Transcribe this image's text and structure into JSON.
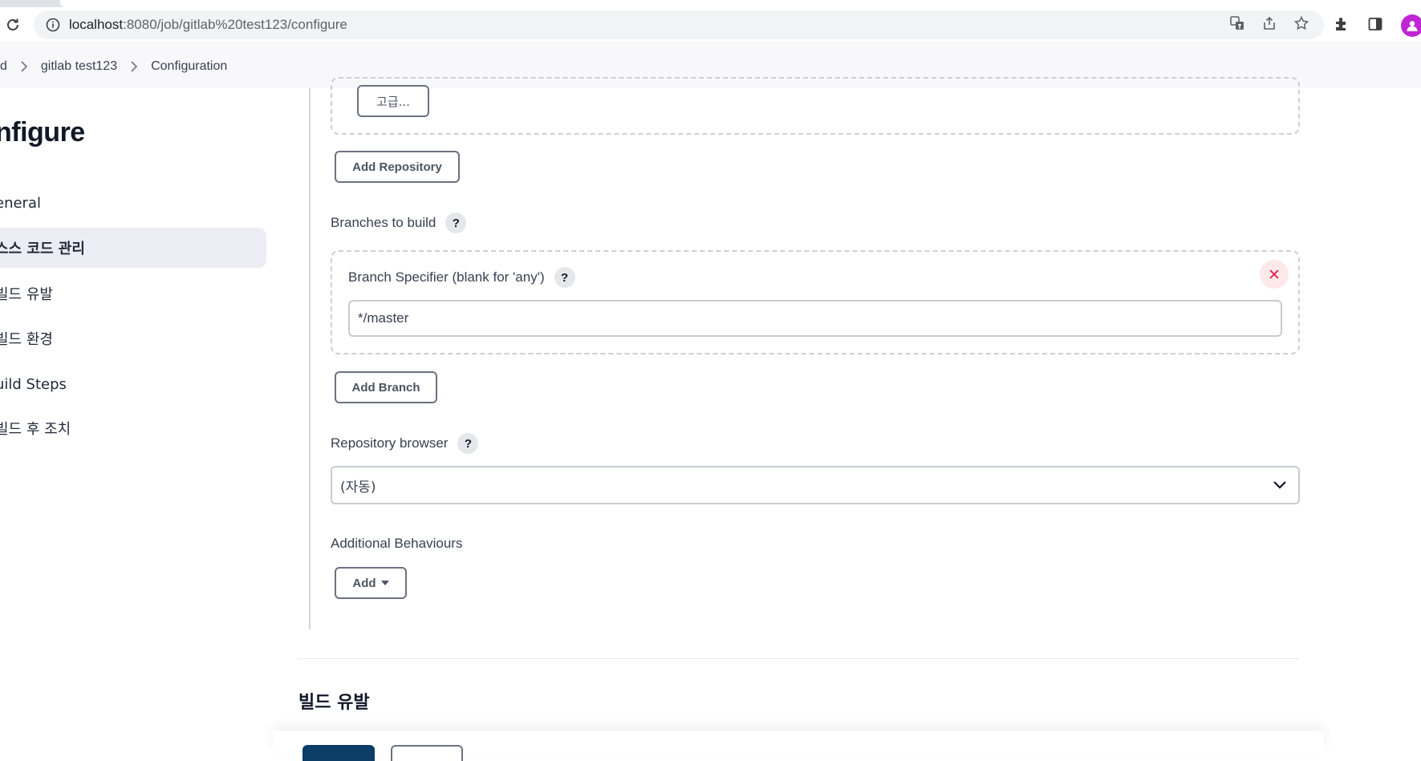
{
  "browser": {
    "url_host": "localhost",
    "url_path": ":8080/job/gitlab%20test123/configure"
  },
  "breadcrumb": {
    "items": [
      "d",
      "gitlab test123",
      "Configuration"
    ]
  },
  "sidebar": {
    "title": "nfigure",
    "items": [
      {
        "label": "eneral",
        "active": false
      },
      {
        "label": "스스 코드 관리",
        "active": true
      },
      {
        "label": "빌드 유발",
        "active": false
      },
      {
        "label": "빌드 환경",
        "active": false
      },
      {
        "label": "uild Steps",
        "active": false
      },
      {
        "label": "빌드 후 조치",
        "active": false
      }
    ]
  },
  "form": {
    "advanced_label": "고급...",
    "add_repository_label": "Add Repository",
    "branches_to_build_label": "Branches to build",
    "branch_specifier_label": "Branch Specifier (blank for 'any')",
    "branch_specifier_value": "*/master",
    "add_branch_label": "Add Branch",
    "repository_browser_label": "Repository browser",
    "repository_browser_value": "(자동)",
    "additional_behaviours_label": "Additional Behaviours",
    "add_label": "Add",
    "help_glyph": "?"
  },
  "next_section": {
    "title": "빌드 유발"
  },
  "colors": {
    "accent_dark": "#0b3d66",
    "active_nav_bg": "#ececf4",
    "danger_bg": "#fde8ea",
    "danger_icon": "#e11d48"
  }
}
